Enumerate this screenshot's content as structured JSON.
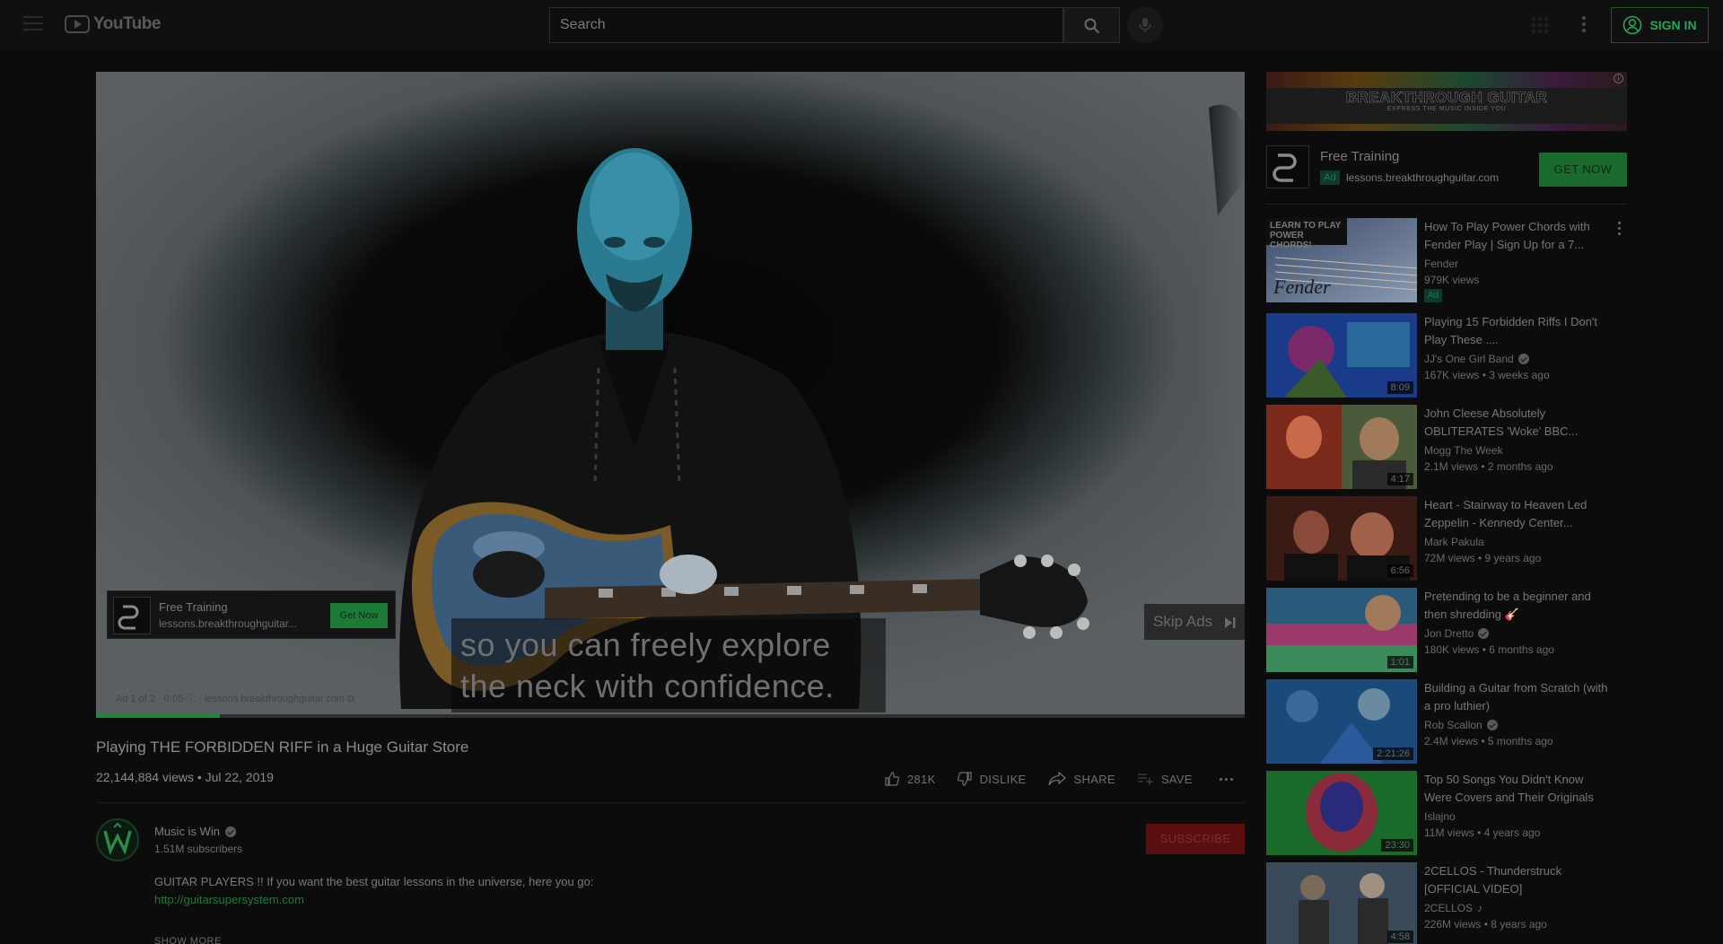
{
  "header": {
    "logo_text": "YouTube",
    "search_placeholder": "Search",
    "signin_label": "SIGN IN"
  },
  "player": {
    "progress_fraction": 0.108,
    "overlay_ad": {
      "title": "Free Training",
      "url": "lessons.breakthroughguitar...",
      "cta": "Get Now"
    },
    "captions": [
      "so you can freely explore",
      "the neck with confidence."
    ],
    "skip_label": "Skip Ads",
    "ad_info": "Ad 1 of 2 · 0:05 ⓘ · lessons.breakthroughguitar.com ⧉"
  },
  "video": {
    "title": "Playing THE FORBIDDEN RIFF in a Huge Guitar Store",
    "meta": "22,144,884 views • Jul 22, 2019",
    "actions": {
      "like": "281K",
      "dislike": "DISLIKE",
      "share": "SHARE",
      "save": "SAVE"
    }
  },
  "channel": {
    "name": "Music is Win",
    "subscribers": "1.51M subscribers",
    "subscribe_label": "SUBSCRIBE",
    "description": "GUITAR PLAYERS !! If you want the best guitar lessons in the universe, here you go:",
    "link": "http://guitarsupersystem.com",
    "show_more": "SHOW MORE"
  },
  "sidebar_ad": {
    "banner_title": "BREAKTHROUGH GUITAR",
    "banner_tagline": "EXPRESS THE MUSIC INSIDE YOU",
    "info_glyph": "i",
    "title": "Free Training",
    "badge": "Ad",
    "url": "lessons.breakthroughguitar.com",
    "cta": "GET NOW"
  },
  "recommendations": [
    {
      "title": "How To Play Power Chords with Fender Play | Sign Up for a 7...",
      "channel": "Fender",
      "verified": false,
      "stats": "979K views",
      "badge": "Ad",
      "duration": "",
      "thumb_text": "LEARN TO PLAY POWER CHORDS!",
      "thumb_brand": "Fender",
      "colors": [
        "#3a4a6a",
        "#8a9ab0",
        "#c8c0b0"
      ]
    },
    {
      "title": "Playing 15 Forbidden Riffs I Don't Play These ....",
      "channel": "JJ's One Girl Band",
      "verified": true,
      "stats": "167K views • 3 weeks ago",
      "duration": "8:09",
      "colors": [
        "#1a3a8a",
        "#7a2a6a",
        "#2a6a9a"
      ]
    },
    {
      "title": "John Cleese Absolutely OBLITERATES 'Woke' BBC...",
      "channel": "Mogg The Week",
      "verified": false,
      "stats": "2.1M views • 2 months ago",
      "duration": "4:17",
      "colors": [
        "#7a2a1a",
        "#c86a4a",
        "#4a5a3a"
      ]
    },
    {
      "title": "Heart - Stairway to Heaven Led Zeppelin - Kennedy Center...",
      "channel": "Mark Pakula",
      "verified": false,
      "stats": "72M views • 9 years ago",
      "duration": "6:56",
      "colors": [
        "#3a1a14",
        "#8a4a3a",
        "#5a2a1a"
      ]
    },
    {
      "title": "Pretending to be a beginner and then shredding 🎸",
      "channel": "Jon Dretto",
      "verified": true,
      "stats": "180K views • 6 months ago",
      "duration": "1:01",
      "colors": [
        "#2a5a7a",
        "#9a3a6a",
        "#3a8a5a"
      ]
    },
    {
      "title": "Building a Guitar from Scratch (with a pro luthier)",
      "channel": "Rob Scallon",
      "verified": true,
      "stats": "2.4M views • 5 months ago",
      "duration": "2:21:26",
      "colors": [
        "#1a4a7a",
        "#3a6a9a",
        "#6a8aa0"
      ]
    },
    {
      "title": "Top 50 Songs You Didn't Know Were Covers and Their Originals",
      "channel": "Islajno",
      "verified": false,
      "stats": "11M views • 4 years ago",
      "duration": "23:30",
      "colors": [
        "#1a6a2a",
        "#8a2a3a",
        "#2a2a7a"
      ]
    },
    {
      "title": "2CELLOS - Thunderstruck [OFFICIAL VIDEO]",
      "channel": "2CELLOS",
      "verified": false,
      "music_note": "♪",
      "stats": "226M views • 8 years ago",
      "duration": "4:58",
      "colors": [
        "#3a4a5a",
        "#7a6a5a",
        "#a09080"
      ]
    }
  ]
}
